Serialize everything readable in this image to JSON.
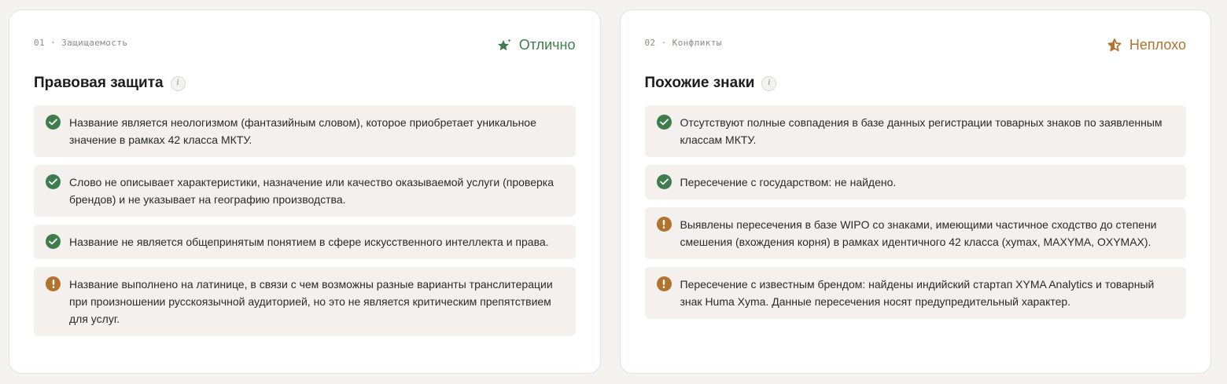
{
  "colors": {
    "good": "#3f7d4c",
    "fair": "#b2732c",
    "item_bg": "#f3f0ed"
  },
  "cards": [
    {
      "kicker": "01 · Защищаемость",
      "rating": {
        "label": "Отлично",
        "icon": "star-sparkle-icon"
      },
      "title": "Правовая защита",
      "info_icon": "i",
      "items": [
        {
          "status": "ok",
          "icon": "check-circle-icon",
          "text": "Название является неологизмом (фантазийным словом), которое приобретает уникальное значение в рамках 42 класса МКТУ."
        },
        {
          "status": "ok",
          "icon": "check-circle-icon",
          "text": "Слово не описывает характеристики, назначение или качество оказываемой услуги (проверка брендов) и не указывает на географию производства."
        },
        {
          "status": "ok",
          "icon": "check-circle-icon",
          "text": "Название не является общепринятым понятием в сфере искусственного интеллекта и права."
        },
        {
          "status": "warn",
          "icon": "exclamation-circle-icon",
          "text": "Название выполнено на латинице, в связи с чем возможны разные варианты транслитерации при произношении русскоязычной аудиторией, но это не является критическим препятствием для услуг."
        }
      ]
    },
    {
      "kicker": "02 · Конфликты",
      "rating": {
        "label": "Неплохо",
        "icon": "star-half-icon"
      },
      "title": "Похожие знаки",
      "info_icon": "i",
      "items": [
        {
          "status": "ok",
          "icon": "check-circle-icon",
          "text": "Отсутствуют полные совпадения в базе данных регистрации товарных знаков по заявленным классам МКТУ."
        },
        {
          "status": "ok",
          "icon": "check-circle-icon",
          "text": "Пересечение с государством: не найдено."
        },
        {
          "status": "warn",
          "icon": "exclamation-circle-icon",
          "text": "Выявлены пересечения в базе WIPO со знаками, имеющими частичное сходство до степени смешения (вхождения корня) в рамках идентичного 42 класса (xymax, MAXYMA, OXYMAX)."
        },
        {
          "status": "warn",
          "icon": "exclamation-circle-icon",
          "text": "Пересечение с известным брендом: найдены индийский стартап XYMA Analytics и товарный знак Huma Xyma. Данные пересечения носят предупредительный характер."
        }
      ]
    }
  ]
}
